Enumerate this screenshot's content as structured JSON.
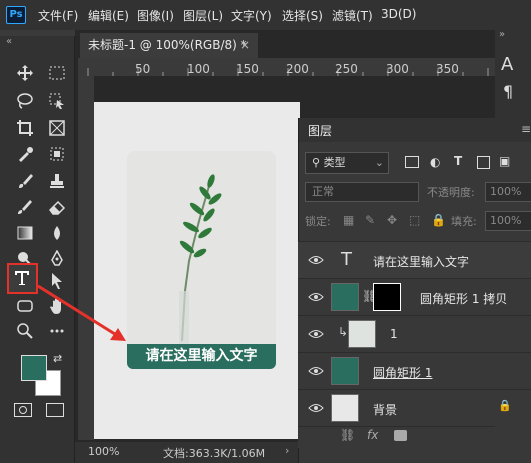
{
  "app": {
    "logo": "Ps"
  },
  "menu": [
    "文件(F)",
    "编辑(E)",
    "图像(I)",
    "图层(L)",
    "文字(Y)",
    "选择(S)",
    "滤镜(T)",
    "3D(D)"
  ],
  "document_tab": {
    "title": "未标题-1 @ 100%(RGB/8) *",
    "close": "×"
  },
  "ruler": {
    "ticks": [
      "50",
      "100",
      "150",
      "200",
      "250",
      "300",
      "350"
    ]
  },
  "canvas": {
    "banner_text": "请在这里输入文字",
    "card_color": "#2a6e5f"
  },
  "status": {
    "zoom": "100%",
    "doc_info": "文档:363.3K/1.06M"
  },
  "right_strip": {
    "text_panel_letters": "A",
    "paragraph_icon": "¶"
  },
  "layers_panel": {
    "title": "图层",
    "filter_label": "类型",
    "blend_mode": "正常",
    "opacity_label": "不透明度:",
    "opacity_value": "100%",
    "lock_label": "锁定:",
    "fill_label": "填充:",
    "fill_value": "100%",
    "layers": [
      {
        "name": "请在这里输入文字",
        "kind": "text"
      },
      {
        "name": "圆角矩形 1 拷贝",
        "kind": "shape-mask"
      },
      {
        "name": "1",
        "kind": "clipped-image"
      },
      {
        "name": "圆角矩形 1",
        "kind": "shape"
      },
      {
        "name": "背景",
        "kind": "background"
      }
    ],
    "footer_icons": [
      "link-icon",
      "fx-icon",
      "mask-icon"
    ],
    "footer_fx": "fx"
  },
  "colors": {
    "foreground": "#2a6e5f",
    "background": "#ffffff",
    "accent": "#e4322b"
  }
}
